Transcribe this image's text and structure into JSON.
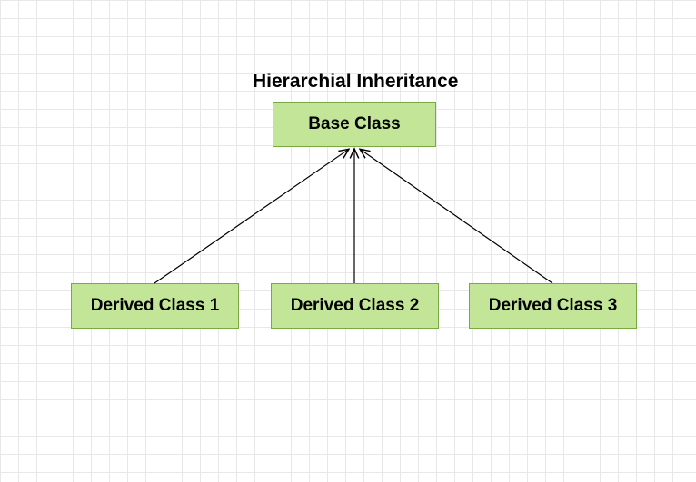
{
  "diagram": {
    "title": "Hierarchial Inheritance",
    "base": {
      "label": "Base Class"
    },
    "derived": [
      {
        "label": "Derived Class 1"
      },
      {
        "label": "Derived Class 2"
      },
      {
        "label": "Derived Class 3"
      }
    ]
  }
}
